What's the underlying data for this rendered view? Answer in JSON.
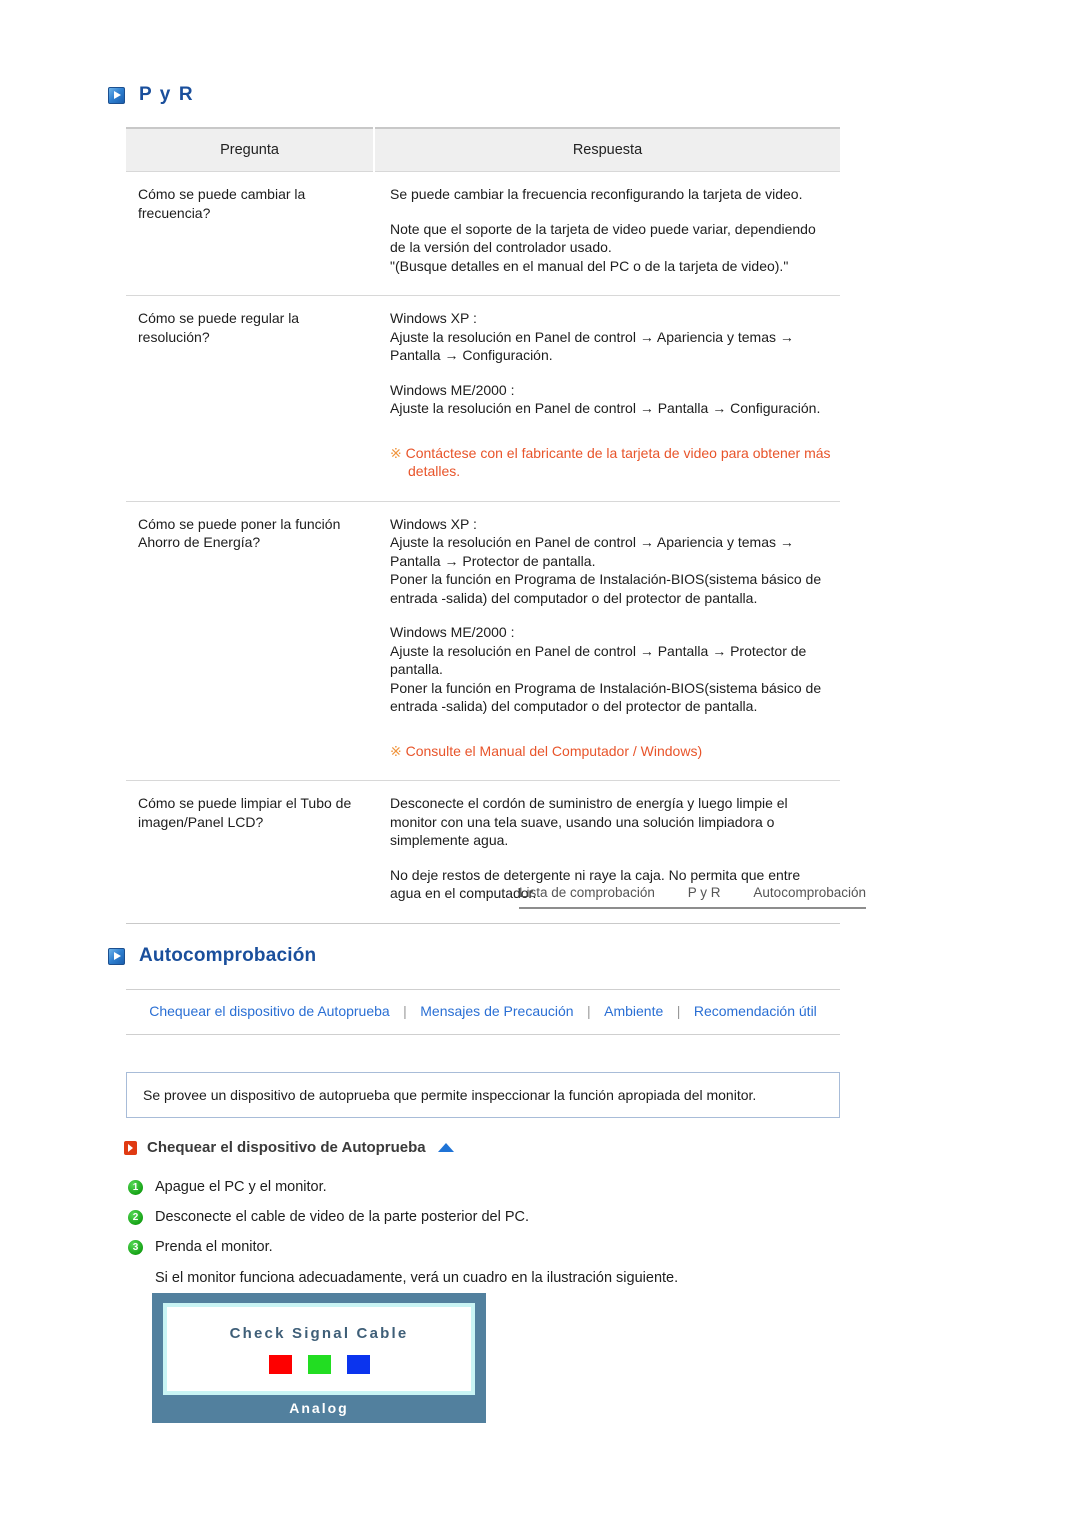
{
  "qa_section": {
    "heading": "P y R",
    "heading_icon": "blue-arrow-icon",
    "table": {
      "columns": [
        "Pregunta",
        "Respuesta"
      ],
      "rows": [
        {
          "question": "Cómo se puede cambiar la frecuencia?",
          "answer_paragraphs": [
            "Se puede cambiar la frecuencia reconfigurando la tarjeta de video.",
            "Note que el soporte de la tarjeta de video puede variar, dependiendo de la versión del controlador usado.\n\"(Busque detalles en el manual del PC o de la tarjeta de video).\""
          ],
          "note": null
        },
        {
          "question": "Cómo se puede regular la resolución?",
          "answer_paragraphs": [
            "Windows XP :\nAjuste la resolución en Panel de control → Apariencia y temas → Pantalla → Configuración.",
            "Windows ME/2000 :\nAjuste la resolución en Panel de control → Pantalla → Configuración."
          ],
          "note": "Contáctese con el fabricante de la tarjeta de video para obtener más detalles."
        },
        {
          "question": "Cómo se puede poner la función Ahorro de Energía?",
          "answer_paragraphs": [
            "Windows XP :\nAjuste la resolución en Panel de control → Apariencia y temas → Pantalla → Protector de pantalla.\nPoner la función en Programa de Instalación-BIOS(sistema básico de entrada -salida) del computador o del protector de pantalla.",
            "Windows ME/2000 :\nAjuste la resolución en Panel de control → Pantalla → Protector de pantalla.\nPoner la función en Programa de Instalación-BIOS(sistema básico de entrada -salida) del computador o del protector de pantalla."
          ],
          "note": "Consulte el Manual del Computador / Windows)"
        },
        {
          "question": "Cómo se puede limpiar el Tubo de imagen/Panel LCD?",
          "answer_paragraphs": [
            "Desconecte el cordón de suministro de energía y luego limpie el monitor con una tela suave, usando una solución limpiadora o simplemente agua.",
            "No deje restos de detergente ni raye la caja. No permita que entre agua en el computador."
          ],
          "note": null
        }
      ]
    }
  },
  "breadcrumb": {
    "items": [
      "Lista de comprobación",
      "P y R",
      "Autocomprobación"
    ]
  },
  "selftest_section": {
    "heading": "Autocomprobación",
    "heading_icon": "blue-arrow-icon",
    "links": [
      "Chequear el dispositivo de Autoprueba",
      "Mensajes de Precaución",
      "Ambiente",
      "Recomendación útil"
    ],
    "separator": "|",
    "info_box": "Se provee un dispositivo de autoprueba que permite inspeccionar la función apropiada del monitor.",
    "subsection": {
      "icon": "red-arrow-icon",
      "title": "Chequear el dispositivo de Autoprueba",
      "top_icon": "blue-up-triangle-icon"
    },
    "steps": [
      {
        "number": "1",
        "text": "Apague el PC y el monitor."
      },
      {
        "number": "2",
        "text": "Desconecte el cable de video de la parte posterior del PC."
      },
      {
        "number": "3",
        "text": "Prenda el monitor."
      }
    ],
    "steps_note": "Si el monitor funciona adecuadamente, verá un cuadro en la ilustración siguiente.",
    "monitor_illustration": {
      "screen_title": "Check Signal Cable",
      "label": "Analog",
      "swatch_colors": [
        "#fe0000",
        "#22dd22",
        "#0b34ee"
      ],
      "bezel_color": "#52809e",
      "screen_border_color": "#c9f4f4"
    }
  }
}
